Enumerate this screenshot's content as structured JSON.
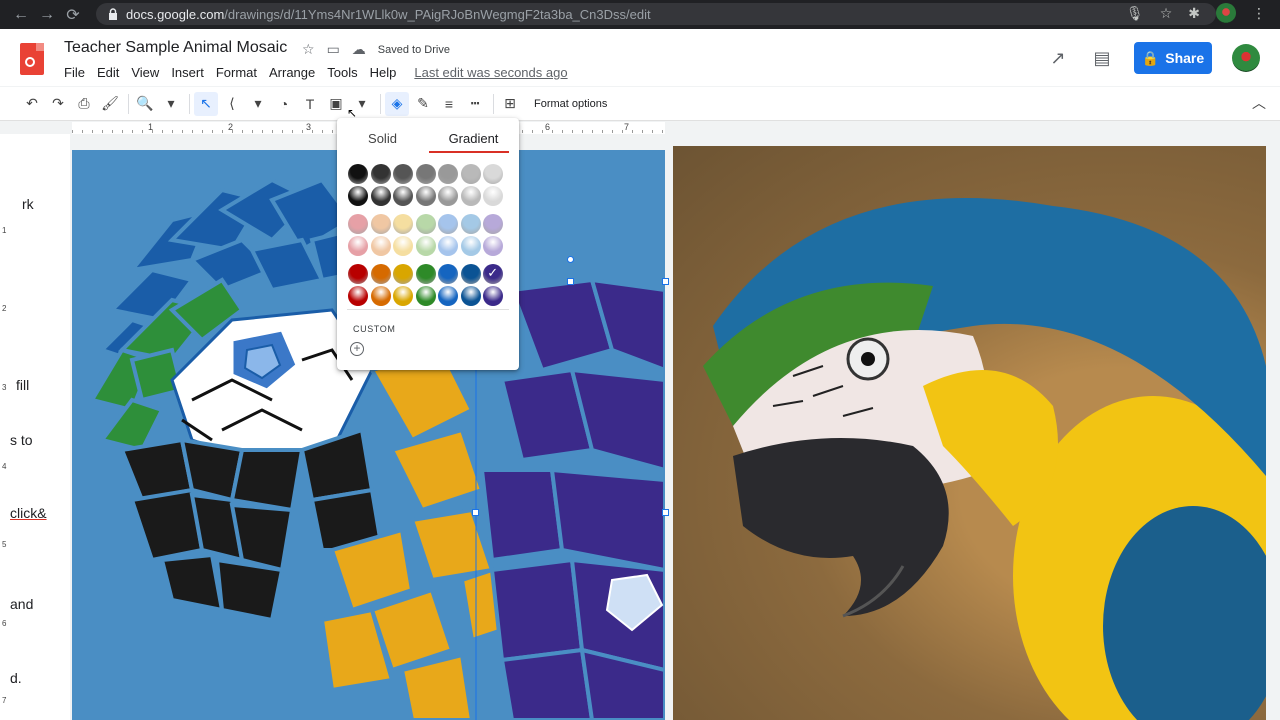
{
  "browser": {
    "url_host": "docs.google.com",
    "url_path": "/drawings/d/11Yms4Nr1WLlk0w_PAigRJoBnWegmgF2ta3ba_Cn3Dss/edit"
  },
  "doc": {
    "title": "Teacher Sample Animal Mosaic",
    "saved_status": "Saved to Drive",
    "last_edit": "Last edit was seconds ago",
    "share_label": "Share"
  },
  "menu": [
    "File",
    "Edit",
    "View",
    "Insert",
    "Format",
    "Arrange",
    "Tools",
    "Help"
  ],
  "toolbar": {
    "format_options_label": "Format options"
  },
  "ruler": {
    "numbers": [
      "1",
      "2",
      "3",
      "6",
      "7"
    ],
    "vertical_numbers": [
      "1",
      "2",
      "3",
      "4",
      "5",
      "6",
      "7"
    ]
  },
  "left_text_fragments": [
    "rk",
    "fill",
    "s to",
    "click&",
    "and",
    "d."
  ],
  "fill_menu": {
    "tabs": [
      "Solid",
      "Gradient"
    ],
    "selected_tab": "Gradient",
    "custom_label": "CUSTOM",
    "swatch_rows": [
      [
        "#111111",
        "#333333",
        "#555555",
        "#777777",
        "#999999",
        "#b9b9b9",
        "#d9d9d9"
      ],
      [
        "#111111",
        "#333333",
        "#555555",
        "#777777",
        "#999999",
        "#b9b9b9",
        "#d9d9d9"
      ],
      [
        "#e6a0a6",
        "#f0c7a3",
        "#f5dea0",
        "#b8d8a8",
        "#a5c4ec",
        "#a4c9e6",
        "#b7a9d9"
      ],
      [
        "#e6a0a6",
        "#f0c7a3",
        "#f5dea0",
        "#b8d8a8",
        "#a5c4ec",
        "#a4c9e6",
        "#b7a9d9"
      ],
      [
        "#b80000",
        "#d66a00",
        "#d9a600",
        "#2e8a28",
        "#1565c0",
        "#0b5394",
        "#3b2a8a"
      ],
      [
        "#b80000",
        "#d66a00",
        "#d9a600",
        "#2e8a28",
        "#1565c0",
        "#0b5394",
        "#3b2a8a"
      ]
    ],
    "checked_swatch": "row 5, column 7"
  },
  "colors": {
    "accent_blue": "#1a73e8",
    "tab_red": "#d93025",
    "canvas_blue": "#4a8ec4"
  }
}
